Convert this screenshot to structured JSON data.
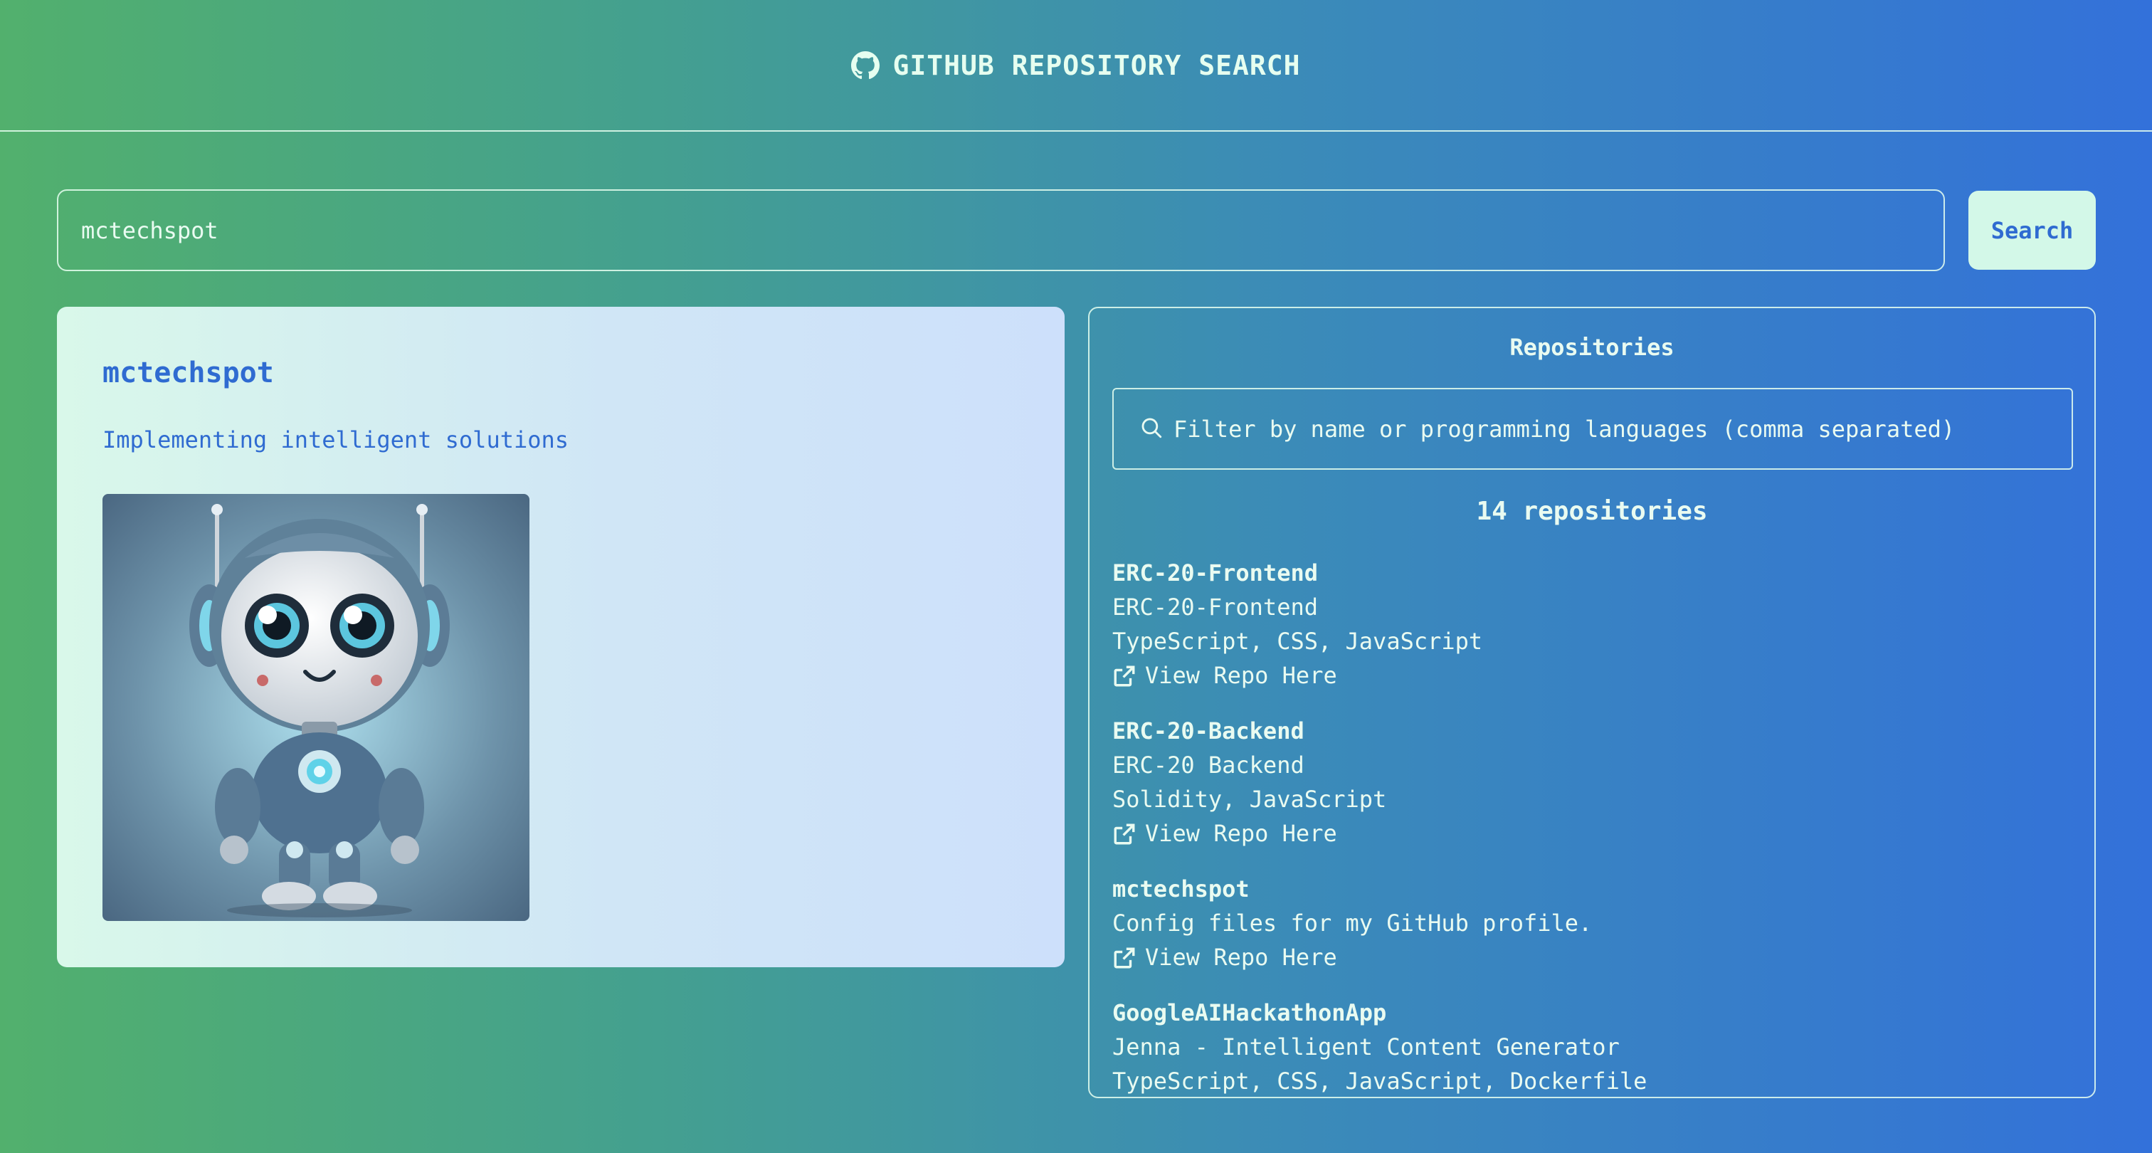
{
  "header": {
    "title": "GITHUB REPOSITORY SEARCH",
    "icon": "github-icon"
  },
  "search": {
    "value": "mctechspot",
    "button_label": "Search"
  },
  "profile": {
    "name": "mctechspot",
    "bio": "Implementing intelligent solutions",
    "avatar_icon": "robot-avatar"
  },
  "repositories": {
    "heading": "Repositories",
    "filter_placeholder": "Filter by name or programming languages (comma separated)",
    "count_label": "14 repositories",
    "link_label": "View Repo Here",
    "items": [
      {
        "name": "ERC-20-Frontend",
        "description": "ERC-20-Frontend",
        "languages": "TypeScript, CSS, JavaScript"
      },
      {
        "name": "ERC-20-Backend",
        "description": "ERC-20 Backend",
        "languages": "Solidity, JavaScript"
      },
      {
        "name": "mctechspot",
        "description": "Config files for my GitHub profile.",
        "languages": ""
      },
      {
        "name": "GoogleAIHackathonApp",
        "description": "Jenna - Intelligent Content Generator",
        "languages": "TypeScript, CSS, JavaScript, Dockerfile"
      }
    ]
  },
  "colors": {
    "accent_blue": "#2f6bd1",
    "button_bg": "#d3f8e8",
    "gradient_start": "#52b06d",
    "gradient_end": "#3371da"
  }
}
